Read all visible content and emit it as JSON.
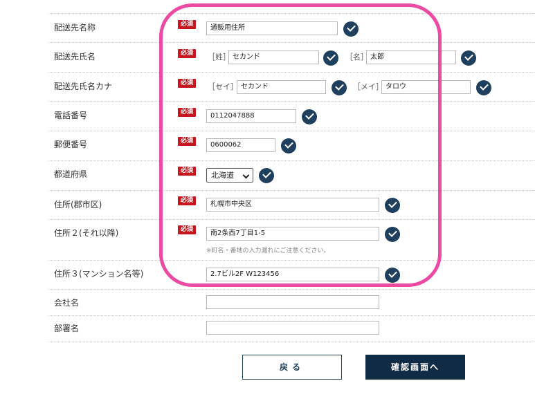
{
  "required_badge": "必須",
  "rows": {
    "ship_name": {
      "label": "配送先名称",
      "value": "通販用住所"
    },
    "ship_person": {
      "label": "配送先氏名",
      "sei_bracket": "［姓］",
      "sei_value": "セカンド",
      "mei_bracket": "［名］",
      "mei_value": "太郎"
    },
    "ship_kana": {
      "label": "配送先氏名カナ",
      "sei_bracket": "［セイ］",
      "sei_value": "セカンド",
      "mei_bracket": "［メイ］",
      "mei_value": "タロウ"
    },
    "phone": {
      "label": "電話番号",
      "value": "0112047888"
    },
    "postal": {
      "label": "郵便番号",
      "value": "0600062"
    },
    "prefecture": {
      "label": "都道府県",
      "selected": "北海道"
    },
    "address1": {
      "label": "住所(郡市区)",
      "value": "札幌市中央区"
    },
    "address2": {
      "label": "住所２(それ以降)",
      "value": "南2条西7丁目1-5",
      "note": "※町名・番地の入力漏れにご注意ください。"
    },
    "address3": {
      "label": "住所３(マンション名等)",
      "value": "2.7ビル2F W123456"
    },
    "company": {
      "label": "会社名",
      "value": ""
    },
    "department": {
      "label": "部署名",
      "value": ""
    }
  },
  "buttons": {
    "back": "戻る",
    "confirm": "確認画面へ"
  },
  "colors": {
    "accent": "#1f3f5e",
    "required": "#c8161e",
    "highlight": "#ec4aa3"
  }
}
